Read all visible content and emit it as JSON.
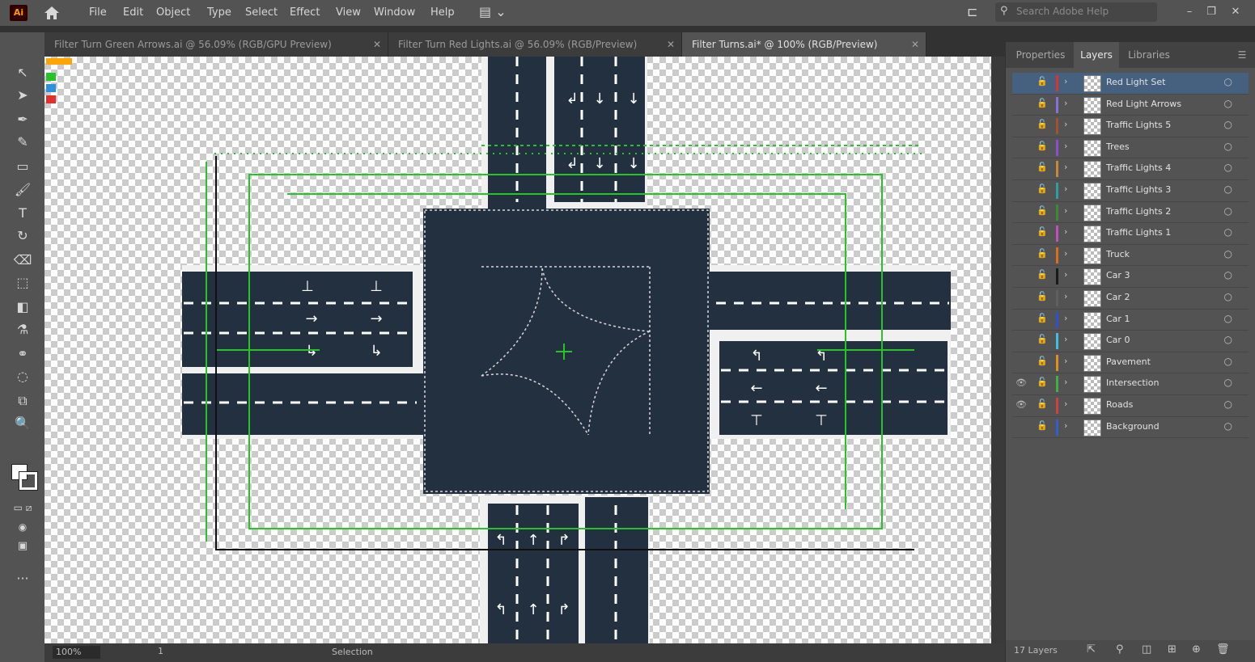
{
  "app": {
    "logo": "Ai"
  },
  "menu": [
    "File",
    "Edit",
    "Object",
    "Type",
    "Select",
    "Effect",
    "View",
    "Window",
    "Help"
  ],
  "search": {
    "placeholder": "Search Adobe Help"
  },
  "tabs": [
    {
      "label": "Filter Turn Green Arrows.ai @ 56.09% (RGB/GPU Preview)",
      "active": false
    },
    {
      "label": "Filter Turn Red Lights.ai @ 56.09% (RGB/Preview)",
      "active": false
    },
    {
      "label": "Filter Turns.ai* @ 100% (RGB/Preview)",
      "active": true
    }
  ],
  "panel": {
    "tabs": [
      "Properties",
      "Layers",
      "Libraries"
    ],
    "active_tab": "Layers",
    "layers": [
      {
        "name": "Red Light Set",
        "color": "#e03030",
        "selected": true,
        "visible": false
      },
      {
        "name": "Red Light Arrows",
        "color": "#8a6fd8",
        "selected": false,
        "visible": false
      },
      {
        "name": "Traffic Lights 5",
        "color": "#a0522d",
        "selected": false,
        "visible": false
      },
      {
        "name": "Trees",
        "color": "#8a4fd0",
        "selected": false,
        "visible": false
      },
      {
        "name": "Traffic Lights 4",
        "color": "#c48a3a",
        "selected": false,
        "visible": false
      },
      {
        "name": "Traffic Lights 3",
        "color": "#2f9e9e",
        "selected": false,
        "visible": false
      },
      {
        "name": "Traffic Lights 2",
        "color": "#3a8a3a",
        "selected": false,
        "visible": false
      },
      {
        "name": "Traffic Lights 1",
        "color": "#c050c0",
        "selected": false,
        "visible": false
      },
      {
        "name": "Truck",
        "color": "#e06a20",
        "selected": false,
        "visible": false
      },
      {
        "name": "Car 3",
        "color": "#1a1a1a",
        "selected": false,
        "visible": false
      },
      {
        "name": "Car 2",
        "color": "#606060",
        "selected": false,
        "visible": false
      },
      {
        "name": "Car 1",
        "color": "#3050d0",
        "selected": false,
        "visible": false
      },
      {
        "name": "Car 0",
        "color": "#40c0e0",
        "selected": false,
        "visible": false
      },
      {
        "name": "Pavement",
        "color": "#e09020",
        "selected": false,
        "visible": false
      },
      {
        "name": "Intersection",
        "color": "#40b040",
        "selected": false,
        "visible": true
      },
      {
        "name": "Roads",
        "color": "#d04040",
        "selected": false,
        "visible": true
      },
      {
        "name": "Background",
        "color": "#3060d0",
        "selected": false,
        "visible": false
      }
    ],
    "footer": {
      "count": "17 Layers"
    }
  },
  "status": {
    "zoom": "100%",
    "artboard": "1",
    "tool": "Selection"
  },
  "colors": {
    "road": "#223040",
    "green_guide": "#27c427",
    "accent": "#46607f"
  }
}
